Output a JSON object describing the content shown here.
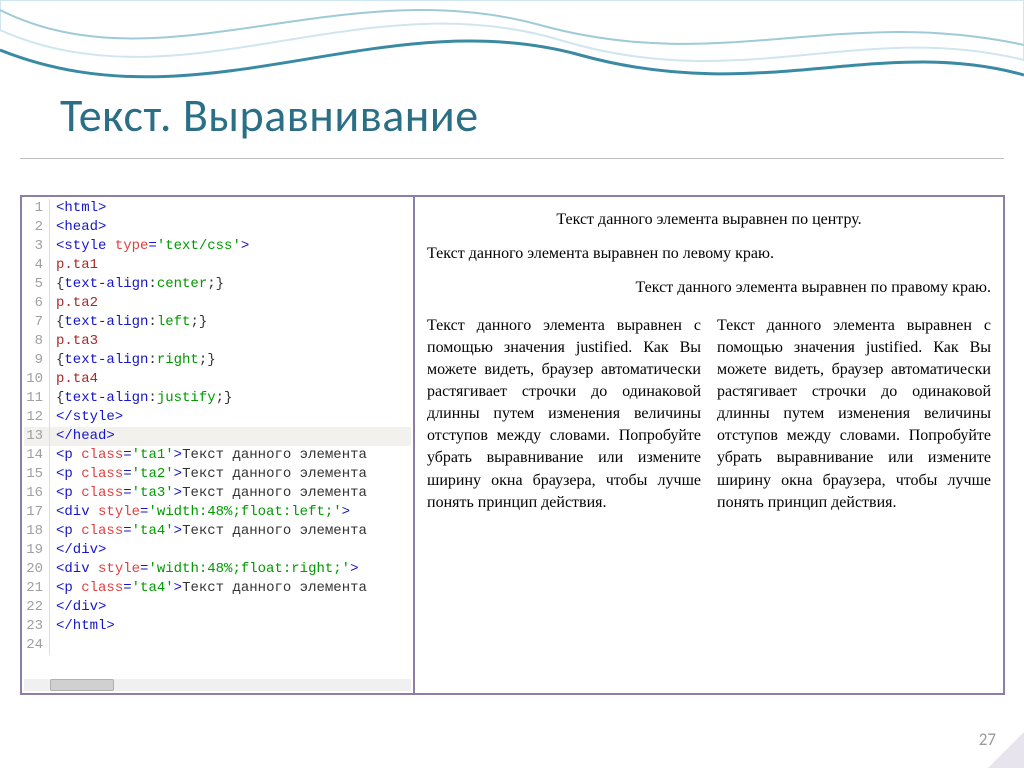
{
  "title": "Текст. Выравнивание",
  "pageNumber": "27",
  "code": {
    "lines": [
      {
        "n": "1",
        "segs": [
          {
            "c": "tag",
            "t": "<html>"
          }
        ]
      },
      {
        "n": "2",
        "segs": [
          {
            "c": "tag",
            "t": "<head>"
          }
        ]
      },
      {
        "n": "3",
        "segs": [
          {
            "c": "tag",
            "t": "<style "
          },
          {
            "c": "attr",
            "t": "type"
          },
          {
            "c": "tag",
            "t": "="
          },
          {
            "c": "val",
            "t": "'text/css'"
          },
          {
            "c": "tag",
            "t": ">"
          }
        ]
      },
      {
        "n": "4",
        "segs": [
          {
            "c": "sel",
            "t": "p.ta1"
          }
        ]
      },
      {
        "n": "5",
        "segs": [
          {
            "c": "txt",
            "t": "{"
          },
          {
            "c": "prop",
            "t": "text-align"
          },
          {
            "c": "txt",
            "t": ":"
          },
          {
            "c": "val",
            "t": "center"
          },
          {
            "c": "txt",
            "t": ";}"
          }
        ]
      },
      {
        "n": "6",
        "segs": [
          {
            "c": "sel",
            "t": "p.ta2"
          }
        ]
      },
      {
        "n": "7",
        "segs": [
          {
            "c": "txt",
            "t": "{"
          },
          {
            "c": "prop",
            "t": "text-align"
          },
          {
            "c": "txt",
            "t": ":"
          },
          {
            "c": "val",
            "t": "left"
          },
          {
            "c": "txt",
            "t": ";}"
          }
        ]
      },
      {
        "n": "8",
        "segs": [
          {
            "c": "sel",
            "t": "p.ta3"
          }
        ]
      },
      {
        "n": "9",
        "segs": [
          {
            "c": "txt",
            "t": "{"
          },
          {
            "c": "prop",
            "t": "text-align"
          },
          {
            "c": "txt",
            "t": ":"
          },
          {
            "c": "val",
            "t": "right"
          },
          {
            "c": "txt",
            "t": ";}"
          }
        ]
      },
      {
        "n": "10",
        "segs": [
          {
            "c": "sel",
            "t": "p.ta4"
          }
        ]
      },
      {
        "n": "11",
        "segs": [
          {
            "c": "txt",
            "t": "{"
          },
          {
            "c": "prop",
            "t": "text-align"
          },
          {
            "c": "txt",
            "t": ":"
          },
          {
            "c": "val",
            "t": "justify"
          },
          {
            "c": "txt",
            "t": ";}"
          }
        ]
      },
      {
        "n": "12",
        "segs": [
          {
            "c": "tag",
            "t": "</style>"
          }
        ]
      },
      {
        "n": "13",
        "segs": [
          {
            "c": "tag",
            "t": "</head>"
          }
        ],
        "hl": true
      },
      {
        "n": "14",
        "segs": [
          {
            "c": "tag",
            "t": "<p "
          },
          {
            "c": "attr",
            "t": "class"
          },
          {
            "c": "tag",
            "t": "="
          },
          {
            "c": "val",
            "t": "'ta1'"
          },
          {
            "c": "tag",
            "t": ">"
          },
          {
            "c": "txt",
            "t": "Текст данного элемента"
          }
        ]
      },
      {
        "n": "15",
        "segs": [
          {
            "c": "tag",
            "t": "<p "
          },
          {
            "c": "attr",
            "t": "class"
          },
          {
            "c": "tag",
            "t": "="
          },
          {
            "c": "val",
            "t": "'ta2'"
          },
          {
            "c": "tag",
            "t": ">"
          },
          {
            "c": "txt",
            "t": "Текст данного элемента"
          }
        ]
      },
      {
        "n": "16",
        "segs": [
          {
            "c": "tag",
            "t": "<p "
          },
          {
            "c": "attr",
            "t": "class"
          },
          {
            "c": "tag",
            "t": "="
          },
          {
            "c": "val",
            "t": "'ta3'"
          },
          {
            "c": "tag",
            "t": ">"
          },
          {
            "c": "txt",
            "t": "Текст данного элемента"
          }
        ]
      },
      {
        "n": "17",
        "segs": [
          {
            "c": "tag",
            "t": "<div "
          },
          {
            "c": "attr",
            "t": "style"
          },
          {
            "c": "tag",
            "t": "="
          },
          {
            "c": "val",
            "t": "'width:48%;float:left;'"
          },
          {
            "c": "tag",
            "t": ">"
          }
        ]
      },
      {
        "n": "18",
        "segs": [
          {
            "c": "tag",
            "t": "<p "
          },
          {
            "c": "attr",
            "t": "class"
          },
          {
            "c": "tag",
            "t": "="
          },
          {
            "c": "val",
            "t": "'ta4'"
          },
          {
            "c": "tag",
            "t": ">"
          },
          {
            "c": "txt",
            "t": "Текст данного элемента"
          }
        ]
      },
      {
        "n": "19",
        "segs": [
          {
            "c": "tag",
            "t": "</div>"
          }
        ]
      },
      {
        "n": "20",
        "segs": [
          {
            "c": "tag",
            "t": "<div "
          },
          {
            "c": "attr",
            "t": "style"
          },
          {
            "c": "tag",
            "t": "="
          },
          {
            "c": "val",
            "t": "'width:48%;float:right;'"
          },
          {
            "c": "tag",
            "t": ">"
          }
        ]
      },
      {
        "n": "21",
        "segs": [
          {
            "c": "tag",
            "t": "<p "
          },
          {
            "c": "attr",
            "t": "class"
          },
          {
            "c": "tag",
            "t": "="
          },
          {
            "c": "val",
            "t": "'ta4'"
          },
          {
            "c": "tag",
            "t": ">"
          },
          {
            "c": "txt",
            "t": "Текст данного элемента"
          }
        ]
      },
      {
        "n": "22",
        "segs": [
          {
            "c": "tag",
            "t": "</div>"
          }
        ]
      },
      {
        "n": "23",
        "segs": [
          {
            "c": "tag",
            "t": "</html>"
          }
        ]
      },
      {
        "n": "24",
        "segs": []
      }
    ]
  },
  "preview": {
    "center": "Текст данного элемента выравнен по центру.",
    "left": "Текст данного элемента выравнен по левому краю.",
    "right": "Текст данного элемента выравнен по правому краю.",
    "justified": "Текст данного элемента выравнен с помощью значения justified. Как Вы можете видеть, браузер автоматически растягивает строчки до одинаковой длинны путем изменения величины отступов между словами. Попробуйте убрать выравнивание или измените ширину окна браузера, чтобы лучше понять принцип действия."
  }
}
